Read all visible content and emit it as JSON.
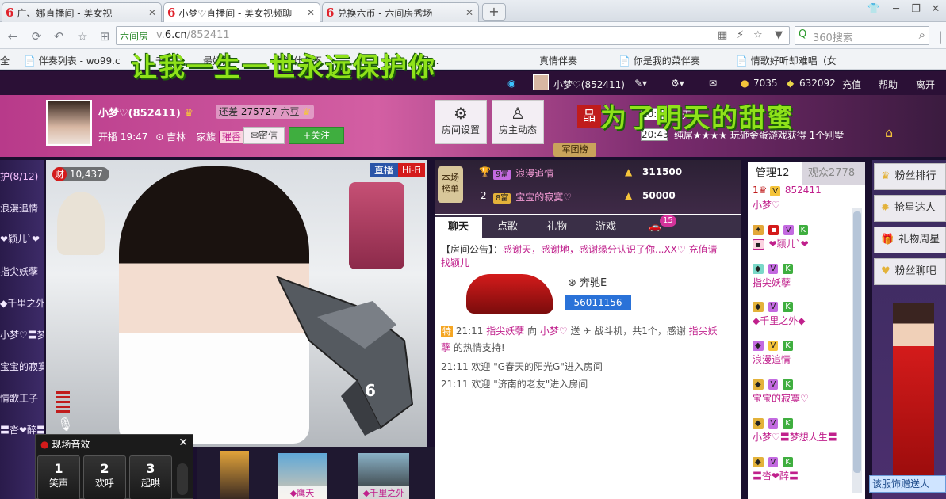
{
  "browser": {
    "tabs": [
      {
        "title": "广、娜直播间 - 美女视"
      },
      {
        "title": "小梦♡直播间 - 美女视频聊"
      },
      {
        "title": "兑换六币 - 六间房秀场"
      }
    ],
    "site_label": "六间房",
    "url_prefix": "v.",
    "url_domain": "6.cn",
    "url_path": "/852411",
    "search_placeholder": "360搜索",
    "bookmarks": [
      "全",
      "伴奏列表 - wo99.c",
      "千...",
      "最好的",
      "你为什么不",
      "是...",
      "真情伴奏",
      "你是我的菜伴奏",
      "情歌好听却难唱（女"
    ]
  },
  "overlays": {
    "top_text": "让我一生一世永远保护你",
    "mid_text": "为了明天的甜蜜"
  },
  "site_bar": {
    "user": "小梦♡(852411)",
    "coins": "7035",
    "beans": "632092",
    "recharge": "充值",
    "help": "帮助",
    "leave": "离开"
  },
  "streamer": {
    "name": "小梦♡",
    "id_text": "(852411)",
    "diff_label": "还差",
    "diff_value": "275727",
    "diff_unit": "六豆",
    "live_label": "开播",
    "live_time": "19:47",
    "location": "吉林",
    "family_label": "家族",
    "family_badge": "璀香",
    "message_btn": "密信",
    "follow_btn": "+关注"
  },
  "header_buttons": {
    "settings": "房间设置",
    "activity": "房主动态"
  },
  "announce": {
    "star_label": "晶",
    "items": [
      {
        "time": "20:43",
        "text": "天"
      },
      {
        "time": "20:43",
        "text": "纯屌★★★★ 玩砸金蛋游戏获得 1个别墅"
      }
    ],
    "army_label": "军团榜"
  },
  "video": {
    "fortune_label": "财",
    "fortune_value": "10,437",
    "live_tag": "直播",
    "hifi_tag": "Hi-Fi"
  },
  "left_list": {
    "header": "护(8/12)",
    "items": [
      "浪漫追情",
      "❤颖儿`❤",
      "指尖妖孽",
      "◆千里之外",
      "小梦♡〓梦",
      "宝宝的寂寞",
      "情歌王子",
      "〓沓❤醉〓"
    ]
  },
  "sound_effects": {
    "title": "现场音效",
    "buttons": [
      {
        "num": "1",
        "label": "笑声"
      },
      {
        "num": "2",
        "label": "欢呼"
      },
      {
        "num": "3",
        "label": "起哄"
      }
    ]
  },
  "bottom_thumbs": [
    "◆鹰天",
    "◆千里之外"
  ],
  "ranking": {
    "label": "本场榜单",
    "rows": [
      {
        "rank": "1",
        "level": "9富",
        "name": "浪漫追情",
        "value": "311500"
      },
      {
        "rank": "2",
        "level": "8富",
        "name": "宝宝的寂寞♡",
        "value": "50000"
      }
    ]
  },
  "chat_tabs": [
    "聊天",
    "点歌",
    "礼物",
    "游戏",
    "15"
  ],
  "chat": {
    "notice_label": "【房间公告】：",
    "notice_text": "感谢天，感谢地，感谢缘分认识了你...XX♡ 充值请找颖儿",
    "car_brand": "奔驰E",
    "car_id": "56011156",
    "messages": [
      {
        "time": "21:11",
        "pre": "指尖妖孽",
        "mid": " 向 ",
        "to": "小梦♡",
        "text": " 送 ",
        "gift": " 战斗机，共1个，感谢 ",
        "thanks": "指尖妖孽",
        "end": " 的热情支持!"
      },
      {
        "time": "21:11",
        "text": "欢迎 \"G春天的阳光G\"进入房间"
      },
      {
        "time": "21:11",
        "text": "欢迎 \"济南的老友\"进入房间"
      }
    ]
  },
  "right_panel": {
    "tab_admin": "管理12",
    "tab_audience": "观众2778",
    "users": [
      {
        "name": "852411"
      },
      {
        "name": "小梦♡"
      },
      {
        "name": "❤颖儿`❤"
      },
      {
        "name": "指尖妖孽"
      },
      {
        "name": "◆千里之外◆"
      },
      {
        "name": "浪漫追情"
      },
      {
        "name": "宝宝的寂寞♡"
      },
      {
        "name": "小梦♡〓梦想人生〓"
      },
      {
        "name": "〓沓❤醉〓"
      }
    ]
  },
  "far_right": {
    "items": [
      "粉丝排行",
      "抢星达人",
      "礼物周星",
      "粉丝聊吧"
    ],
    "gift_banner": "该服饰赠送人"
  }
}
